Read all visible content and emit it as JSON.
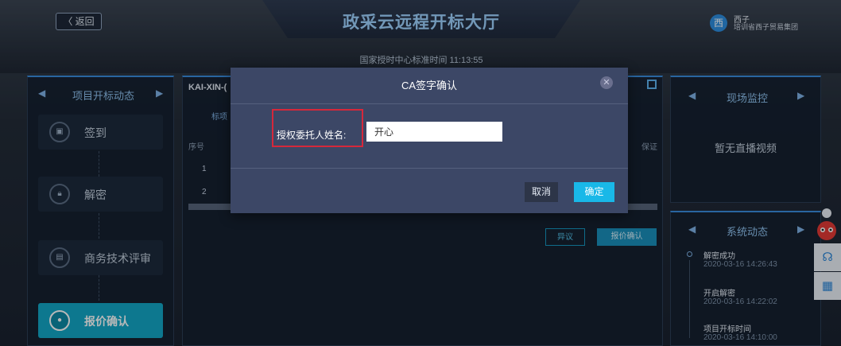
{
  "header": {
    "back_label": "〈 返回",
    "title": "政采云远程开标大厅",
    "clock_label": "国家授时中心标准时间",
    "clock_time": "11:13:55",
    "user": {
      "avatar_char": "西",
      "name": "西子",
      "org": "培训省西子贸易集团"
    }
  },
  "left_panel": {
    "title": "项目开标动态",
    "steps": [
      {
        "label": "签到",
        "icon": "calendar-icon",
        "active": false
      },
      {
        "label": "解密",
        "icon": "lock-icon",
        "active": false
      },
      {
        "label": "商务技术评审",
        "icon": "document-icon",
        "active": false
      },
      {
        "label": "报价确认",
        "icon": "quote-icon",
        "active": true
      }
    ]
  },
  "center_panel": {
    "project_code": "KAI-XIN-(",
    "tab_label": "标项",
    "table": {
      "headers": [
        "序号",
        "保证"
      ],
      "rows": [
        "1",
        "2"
      ]
    },
    "btn_objection": "异议",
    "btn_quote": "报价确认"
  },
  "right_panel": {
    "monitor_title": "现场监控",
    "monitor_empty": "暂无直播视频",
    "feed_title": "系统动态",
    "feed": [
      {
        "title": "解密成功",
        "time": "2020-03-16 14:26:43"
      },
      {
        "title": "开启解密",
        "time": "2020-03-16 14:22:02"
      },
      {
        "title": "项目开标时间",
        "time": "2020-03-16 14:10:00"
      }
    ]
  },
  "modal": {
    "title": "CA签字确认",
    "field_label": "授权委托人姓名:",
    "field_value": "开心",
    "cancel_label": "取消",
    "ok_label": "确定"
  },
  "colors": {
    "accent": "#19b8e8",
    "highlight_box": "#d6283b",
    "modal_bg": "#3c4766"
  }
}
